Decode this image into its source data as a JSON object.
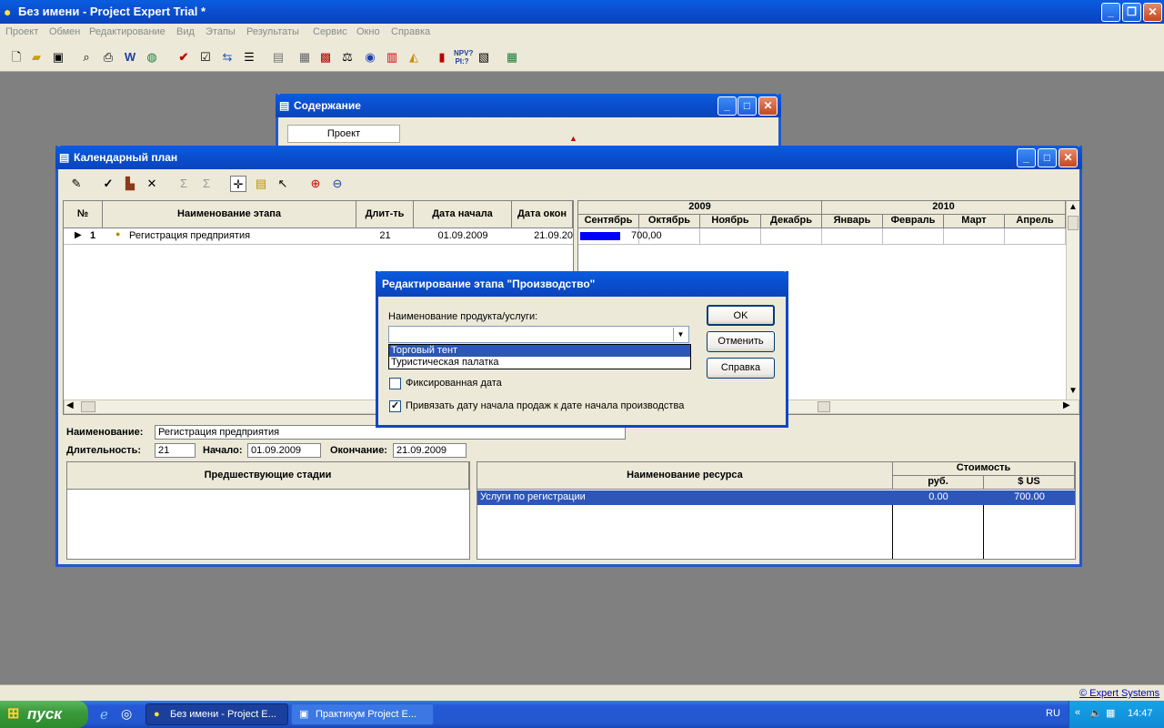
{
  "app": {
    "title": "Без имени - Project Expert Trial *",
    "menu": [
      "Проект",
      "Обмен",
      "Редактирование",
      "Вид",
      "Этапы",
      "Результаты",
      "Сервис",
      "Окно",
      "Справка"
    ]
  },
  "contents_window": {
    "title": "Содержание",
    "tab": "Проект"
  },
  "calendar_window": {
    "title": "Календарный план",
    "columns": [
      "№",
      "Наименование этапа",
      "Длит-ть",
      "Дата начала",
      "Дата окон"
    ],
    "rows": [
      {
        "num": "1",
        "name": "Регистрация предприятия",
        "duration": "21",
        "start": "01.09.2009",
        "end": "21.09.20"
      }
    ],
    "gantt": {
      "years": [
        "2009",
        "2010"
      ],
      "months": [
        "Сентябрь",
        "Октябрь",
        "Ноябрь",
        "Декабрь",
        "Январь",
        "Февраль",
        "Март",
        "Апрель"
      ],
      "bar_value": "700,00",
      "bar_color": "#0000ff"
    },
    "details": {
      "name_label": "Наименование:",
      "name_value": "Регистрация предприятия",
      "duration_label": "Длительность:",
      "duration_value": "21",
      "start_label": "Начало:",
      "start_value": "01.09.2009",
      "end_label": "Окончание:",
      "end_value": "21.09.2009",
      "predecessors_header": "Предшествующие стадии",
      "resource_header": "Наименование ресурса",
      "cost_header": "Стоимость",
      "rub_header": "руб.",
      "usd_header": "$ US",
      "resources": [
        {
          "name": "Услуги по регистрации",
          "rub": "0.00",
          "usd": "700.00"
        }
      ]
    }
  },
  "dialog": {
    "title": "Редактирование этапа \"Производство\"",
    "product_label": "Наименование продукта/услуги:",
    "product_value": "",
    "options": [
      "Торговый тент",
      "Туристическая палатка"
    ],
    "fixed_date_label": "Фиксированная дата",
    "bind_date_label": "Привязать дату начала продаж к дате начала производства",
    "ok": "OK",
    "cancel": "Отменить",
    "help": "Справка"
  },
  "status": {
    "link": "© Expert Systems"
  },
  "taskbar": {
    "start": "пуск",
    "tasks": [
      "Без имени - Project E...",
      "Практикум Project E..."
    ],
    "lang": "RU",
    "time": "14:47"
  }
}
